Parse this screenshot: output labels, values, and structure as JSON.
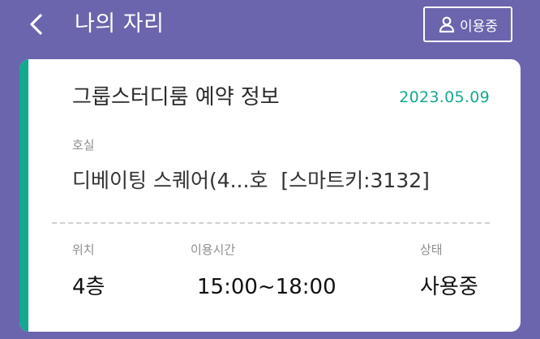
{
  "header": {
    "title": "나의 자리",
    "back_icon": "chevron-left-icon",
    "status_button": {
      "icon": "user-icon",
      "label": "이용중"
    }
  },
  "reservation": {
    "title": "그룹스터디룸 예약 정보",
    "date": "2023.05.09",
    "room_label": "호실",
    "room_value": "디베이팅 스퀘어(4...호  [스마트키:3132]",
    "location_label": "위치",
    "location_value": "4층",
    "time_label": "이용시간",
    "time_value": "15:00~18:00",
    "status_label": "상태",
    "status_value": "사용중"
  },
  "colors": {
    "background": "#6b65ad",
    "accent": "#13a890",
    "card": "#ffffff"
  }
}
